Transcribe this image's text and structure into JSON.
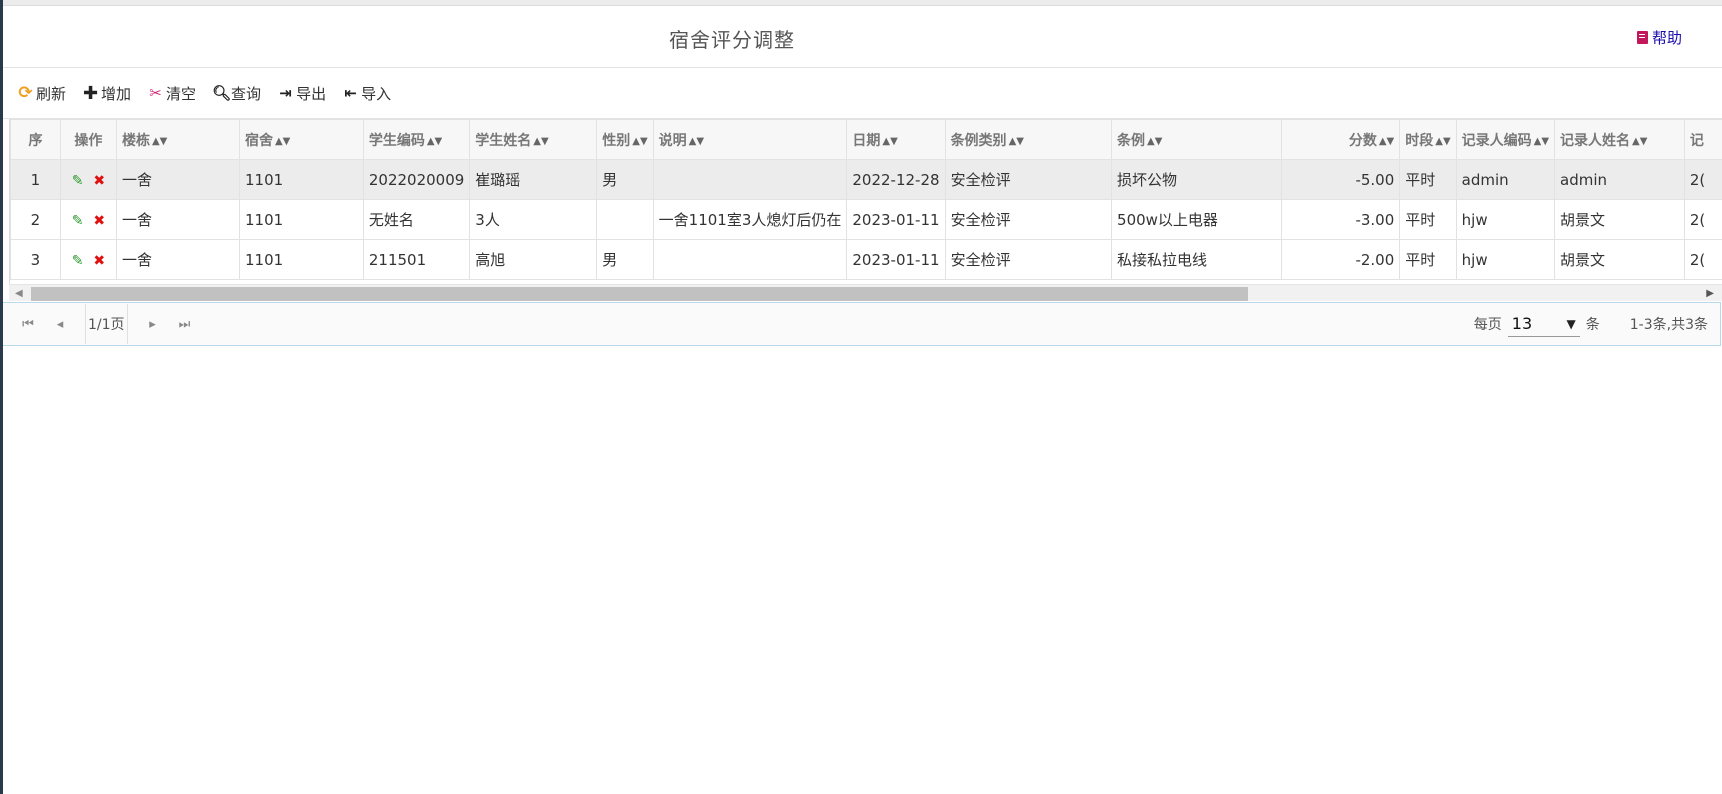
{
  "header": {
    "title": "宿舍评分调整",
    "help_label": "帮助"
  },
  "toolbar": {
    "refresh": "刷新",
    "add": "增加",
    "clear": "清空",
    "query": "查询",
    "export": "导出",
    "import": "导入"
  },
  "table": {
    "headers": {
      "seq": "序",
      "ops": "操作",
      "building": "楼栋",
      "dorm": "宿舍",
      "student_code": "学生编码",
      "student_name": "学生姓名",
      "gender": "性别",
      "desc": "说明",
      "date": "日期",
      "rule_category": "条例类别",
      "rule": "条例",
      "score": "分数",
      "period": "时段",
      "recorder_code": "记录人编码",
      "recorder_name": "记录人姓名",
      "record_time": "记"
    },
    "rows": [
      {
        "seq": "1",
        "building": "一舍",
        "dorm": "1101",
        "student_code": "2022020009",
        "student_name": "崔璐瑶",
        "gender": "男",
        "desc": "",
        "date": "2022-12-28",
        "rule_category": "安全检评",
        "rule": "损坏公物",
        "score": "-5.00",
        "period": "平时",
        "recorder_code": "admin",
        "recorder_name": "admin",
        "record_time": "2("
      },
      {
        "seq": "2",
        "building": "一舍",
        "dorm": "1101",
        "student_code": "无姓名",
        "student_name": "3人",
        "gender": "",
        "desc": "一舍1101室3人熄灯后仍在",
        "date": "2023-01-11",
        "rule_category": "安全检评",
        "rule": "500w以上电器",
        "score": "-3.00",
        "period": "平时",
        "recorder_code": "hjw",
        "recorder_name": "胡景文",
        "record_time": "2("
      },
      {
        "seq": "3",
        "building": "一舍",
        "dorm": "1101",
        "student_code": "211501",
        "student_name": "高旭",
        "gender": "男",
        "desc": "",
        "date": "2023-01-11",
        "rule_category": "安全检评",
        "rule": "私接私拉电线",
        "score": "-2.00",
        "period": "平时",
        "recorder_code": "hjw",
        "recorder_name": "胡景文",
        "record_time": "2("
      }
    ]
  },
  "pager": {
    "page_info": "1/1页",
    "per_page_label": "每页",
    "per_page_value": "13",
    "unit_label": "条",
    "total_text": "1-3条,共3条"
  },
  "colors": {
    "refresh_icon": "#f0a020",
    "clear_icon": "#d0307a",
    "edit_icon": "#2e9a2e",
    "delete_icon": "#e01010",
    "help_icon": "#c2185b",
    "help_link": "#1a0dab"
  }
}
